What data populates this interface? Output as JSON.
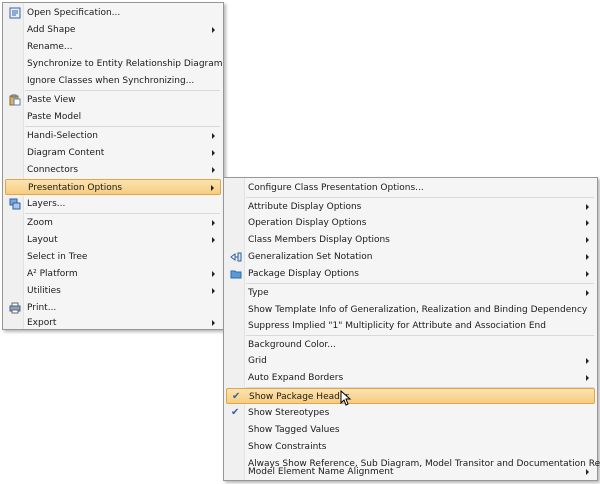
{
  "context_menu": {
    "items": [
      {
        "label": "Open Specification...",
        "submenu": false,
        "icon": "specification-icon"
      },
      {
        "label": "Add Shape",
        "submenu": true
      },
      {
        "label": "Rename...",
        "submenu": false
      },
      {
        "label": "Synchronize to Entity Relationship Diagram",
        "submenu": false
      },
      {
        "label": "Ignore Classes when Synchronizing...",
        "submenu": false
      },
      {
        "label": "Paste View",
        "submenu": false,
        "icon": "paste-icon"
      },
      {
        "label": "Paste Model",
        "submenu": false
      },
      {
        "label": "Handi-Selection",
        "submenu": true
      },
      {
        "label": "Diagram Content",
        "submenu": true
      },
      {
        "label": "Connectors",
        "submenu": true
      },
      {
        "label": "Presentation Options",
        "submenu": true,
        "highlighted": true
      },
      {
        "label": "Layers...",
        "submenu": false,
        "icon": "layers-icon"
      },
      {
        "label": "Zoom",
        "submenu": true
      },
      {
        "label": "Layout",
        "submenu": true
      },
      {
        "label": "Select in Tree",
        "submenu": false
      },
      {
        "label": "A² Platform",
        "submenu": true
      },
      {
        "label": "Utilities",
        "submenu": true
      },
      {
        "label": "Print...",
        "submenu": false,
        "icon": "printer-icon"
      },
      {
        "label": "Export",
        "submenu": true
      }
    ]
  },
  "presentation_options_submenu": {
    "items": [
      {
        "label": "Configure Class Presentation Options...",
        "submenu": false
      },
      {
        "label": "Attribute Display Options",
        "submenu": true
      },
      {
        "label": "Operation Display Options",
        "submenu": true
      },
      {
        "label": "Class Members Display Options",
        "submenu": true
      },
      {
        "label": "Generalization Set Notation",
        "submenu": true,
        "icon": "generalization-icon"
      },
      {
        "label": "Package Display Options",
        "submenu": true,
        "icon": "folder-icon"
      },
      {
        "label": "Type",
        "submenu": true
      },
      {
        "label": "Show Template Info of Generalization, Realization and Binding Dependency",
        "submenu": false
      },
      {
        "label": "Suppress Implied \"1\" Multiplicity for Attribute and Association End",
        "submenu": false
      },
      {
        "label": "Background Color...",
        "submenu": false
      },
      {
        "label": "Grid",
        "submenu": true
      },
      {
        "label": "Auto Expand Borders",
        "submenu": true
      },
      {
        "label": "Show Package Header",
        "submenu": false,
        "checked": true,
        "highlighted": true
      },
      {
        "label": "Show Stereotypes",
        "submenu": false,
        "checked": true
      },
      {
        "label": "Show Tagged Values",
        "submenu": false
      },
      {
        "label": "Show Constraints",
        "submenu": false
      },
      {
        "label": "Always Show Reference, Sub Diagram, Model Transitor and Documentation Resource",
        "submenu": false
      },
      {
        "label": "Model Element Name Alignment",
        "submenu": true
      }
    ]
  },
  "colors": {
    "menu_background": "#f5f5f5",
    "highlight": "#f7cd7f",
    "highlight_border": "#e3a646",
    "check_color": "#3b5f9e"
  }
}
